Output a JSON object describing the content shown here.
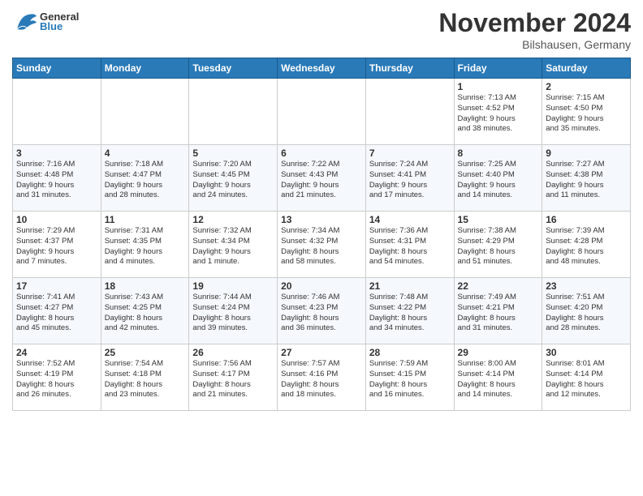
{
  "header": {
    "logo_general": "General",
    "logo_blue": "Blue",
    "month_title": "November 2024",
    "location": "Bilshausen, Germany"
  },
  "weekdays": [
    "Sunday",
    "Monday",
    "Tuesday",
    "Wednesday",
    "Thursday",
    "Friday",
    "Saturday"
  ],
  "weeks": [
    [
      {
        "day": "",
        "info": ""
      },
      {
        "day": "",
        "info": ""
      },
      {
        "day": "",
        "info": ""
      },
      {
        "day": "",
        "info": ""
      },
      {
        "day": "",
        "info": ""
      },
      {
        "day": "1",
        "info": "Sunrise: 7:13 AM\nSunset: 4:52 PM\nDaylight: 9 hours\nand 38 minutes."
      },
      {
        "day": "2",
        "info": "Sunrise: 7:15 AM\nSunset: 4:50 PM\nDaylight: 9 hours\nand 35 minutes."
      }
    ],
    [
      {
        "day": "3",
        "info": "Sunrise: 7:16 AM\nSunset: 4:48 PM\nDaylight: 9 hours\nand 31 minutes."
      },
      {
        "day": "4",
        "info": "Sunrise: 7:18 AM\nSunset: 4:47 PM\nDaylight: 9 hours\nand 28 minutes."
      },
      {
        "day": "5",
        "info": "Sunrise: 7:20 AM\nSunset: 4:45 PM\nDaylight: 9 hours\nand 24 minutes."
      },
      {
        "day": "6",
        "info": "Sunrise: 7:22 AM\nSunset: 4:43 PM\nDaylight: 9 hours\nand 21 minutes."
      },
      {
        "day": "7",
        "info": "Sunrise: 7:24 AM\nSunset: 4:41 PM\nDaylight: 9 hours\nand 17 minutes."
      },
      {
        "day": "8",
        "info": "Sunrise: 7:25 AM\nSunset: 4:40 PM\nDaylight: 9 hours\nand 14 minutes."
      },
      {
        "day": "9",
        "info": "Sunrise: 7:27 AM\nSunset: 4:38 PM\nDaylight: 9 hours\nand 11 minutes."
      }
    ],
    [
      {
        "day": "10",
        "info": "Sunrise: 7:29 AM\nSunset: 4:37 PM\nDaylight: 9 hours\nand 7 minutes."
      },
      {
        "day": "11",
        "info": "Sunrise: 7:31 AM\nSunset: 4:35 PM\nDaylight: 9 hours\nand 4 minutes."
      },
      {
        "day": "12",
        "info": "Sunrise: 7:32 AM\nSunset: 4:34 PM\nDaylight: 9 hours\nand 1 minute."
      },
      {
        "day": "13",
        "info": "Sunrise: 7:34 AM\nSunset: 4:32 PM\nDaylight: 8 hours\nand 58 minutes."
      },
      {
        "day": "14",
        "info": "Sunrise: 7:36 AM\nSunset: 4:31 PM\nDaylight: 8 hours\nand 54 minutes."
      },
      {
        "day": "15",
        "info": "Sunrise: 7:38 AM\nSunset: 4:29 PM\nDaylight: 8 hours\nand 51 minutes."
      },
      {
        "day": "16",
        "info": "Sunrise: 7:39 AM\nSunset: 4:28 PM\nDaylight: 8 hours\nand 48 minutes."
      }
    ],
    [
      {
        "day": "17",
        "info": "Sunrise: 7:41 AM\nSunset: 4:27 PM\nDaylight: 8 hours\nand 45 minutes."
      },
      {
        "day": "18",
        "info": "Sunrise: 7:43 AM\nSunset: 4:25 PM\nDaylight: 8 hours\nand 42 minutes."
      },
      {
        "day": "19",
        "info": "Sunrise: 7:44 AM\nSunset: 4:24 PM\nDaylight: 8 hours\nand 39 minutes."
      },
      {
        "day": "20",
        "info": "Sunrise: 7:46 AM\nSunset: 4:23 PM\nDaylight: 8 hours\nand 36 minutes."
      },
      {
        "day": "21",
        "info": "Sunrise: 7:48 AM\nSunset: 4:22 PM\nDaylight: 8 hours\nand 34 minutes."
      },
      {
        "day": "22",
        "info": "Sunrise: 7:49 AM\nSunset: 4:21 PM\nDaylight: 8 hours\nand 31 minutes."
      },
      {
        "day": "23",
        "info": "Sunrise: 7:51 AM\nSunset: 4:20 PM\nDaylight: 8 hours\nand 28 minutes."
      }
    ],
    [
      {
        "day": "24",
        "info": "Sunrise: 7:52 AM\nSunset: 4:19 PM\nDaylight: 8 hours\nand 26 minutes."
      },
      {
        "day": "25",
        "info": "Sunrise: 7:54 AM\nSunset: 4:18 PM\nDaylight: 8 hours\nand 23 minutes."
      },
      {
        "day": "26",
        "info": "Sunrise: 7:56 AM\nSunset: 4:17 PM\nDaylight: 8 hours\nand 21 minutes."
      },
      {
        "day": "27",
        "info": "Sunrise: 7:57 AM\nSunset: 4:16 PM\nDaylight: 8 hours\nand 18 minutes."
      },
      {
        "day": "28",
        "info": "Sunrise: 7:59 AM\nSunset: 4:15 PM\nDaylight: 8 hours\nand 16 minutes."
      },
      {
        "day": "29",
        "info": "Sunrise: 8:00 AM\nSunset: 4:14 PM\nDaylight: 8 hours\nand 14 minutes."
      },
      {
        "day": "30",
        "info": "Sunrise: 8:01 AM\nSunset: 4:14 PM\nDaylight: 8 hours\nand 12 minutes."
      }
    ]
  ]
}
